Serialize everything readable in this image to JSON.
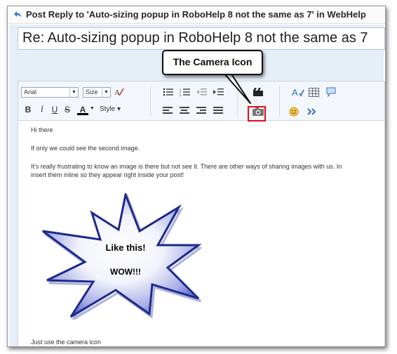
{
  "window": {
    "title": "Post Reply to 'Auto-sizing popup in RoboHelp 8 not the same as 7' in WebHelp"
  },
  "subject": {
    "value": "Re: Auto-sizing popup in RoboHelp 8 not the same as 7"
  },
  "toolbar": {
    "font_value": "Arial",
    "size_value": "Size",
    "style_label": "Style",
    "bold": "B",
    "italic": "i",
    "underline": "U",
    "strike": "S",
    "font_color": "A"
  },
  "callout": {
    "text": "The Camera Icon"
  },
  "editor": {
    "line1": "Hi there",
    "line2": "If only we could see the second image.",
    "line3": "It's really frustrating to know an image is there but not see it. There are other ways of sharing images with us. In",
    "line4": "insert them inline so they appear right inside your post!",
    "image_text1": "Like this!",
    "image_text2": "WOW!!!",
    "line5": "Just use the camera icon"
  },
  "colors": {
    "highlight": "#e0101a",
    "panel": "#e6eef7"
  }
}
